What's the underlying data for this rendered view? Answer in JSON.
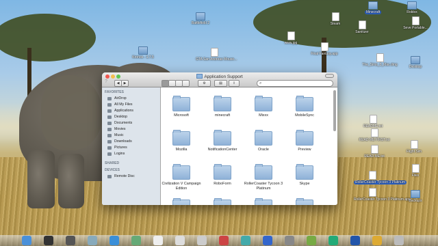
{
  "desktop_icons": [
    {
      "label": "Minecraft",
      "type": "folder",
      "sel": true
    },
    {
      "label": "Roblox",
      "type": "folder",
      "sel": false
    },
    {
      "label": "Steam",
      "type": "doc",
      "sel": false
    },
    {
      "label": "Sanitizer",
      "type": "doc",
      "sel": false
    },
    {
      "label": "Seve Portable...",
      "type": "doc",
      "sel": false
    },
    {
      "label": "Kronos - 1.7.5",
      "type": "folder",
      "sel": false
    },
    {
      "label": "GTA San Andreas Mouse...",
      "type": "doc",
      "sel": false
    },
    {
      "label": "Battlefield 2",
      "type": "folder",
      "sel": false
    },
    {
      "label": "www.jpg",
      "type": "doc",
      "sel": false
    },
    {
      "label": "Final Fantasy.app",
      "type": "doc",
      "sel": false
    },
    {
      "label": "The_Sims_3_Mac.dmg",
      "type": "doc",
      "sel": false
    },
    {
      "label": "Desktop",
      "type": "folder",
      "sel": false
    },
    {
      "label": "README.txt",
      "type": "doc",
      "sel": false
    },
    {
      "label": "READ ME FIRST.txt",
      "type": "doc",
      "sel": false
    },
    {
      "label": "READ ME.txt",
      "type": "doc",
      "sel": false
    },
    {
      "label": "Flight Sim",
      "type": "doc",
      "sel": false
    },
    {
      "label": "RollerCoaster Tycoon 3 Platinum",
      "type": "doc",
      "sel": true
    },
    {
      "label": "RollerCoaster Tycoon 3 Platinum.app",
      "type": "doc",
      "sel": false
    },
    {
      "label": "Files",
      "type": "doc",
      "sel": false
    },
    {
      "label": "Backups",
      "type": "folder",
      "sel": false
    }
  ],
  "finder": {
    "title": "Application Support",
    "help_glyph": "?",
    "nav_back": "◀",
    "nav_forward": "▶",
    "action_glyph": "⚙",
    "arrange_glyph": "▤",
    "share_glyph": "⇪",
    "search_glyph": "⌕",
    "sidebar": {
      "favorites_header": "FAVORITES",
      "favorites": [
        "AirDrop",
        "All My Files",
        "Applications",
        "Desktop",
        "Documents",
        "Movies",
        "Music",
        "Downloads",
        "Pictures",
        "Logins"
      ],
      "shared_header": "SHARED",
      "devices_header": "DEVICES",
      "devices": [
        "Remote Disc"
      ]
    },
    "items": [
      "Microsoft",
      "minecraft",
      "Mixxx",
      "MobileSync",
      "Mozilla",
      "NotificationCenter",
      "Oracle",
      "Preview",
      "Civilization V Campaign Edition",
      "RoboForm",
      "RollerCoaster Tycoon 3 Platinum",
      "Skype",
      "",
      "",
      "",
      ""
    ]
  },
  "colors": {
    "window_bg": "#ffffff",
    "sidebar_bg": "#dde4eb",
    "selection": "#2b62c9",
    "close": "#f0584f",
    "minimize": "#f5be4f",
    "zoom": "#61c554"
  },
  "dock_icons": [
    "finder-icon",
    "dashboard-icon",
    "mission-control-icon",
    "mail-icon",
    "safari-icon",
    "photos-icon",
    "calendar-icon",
    "notes-icon",
    "reminders-icon",
    "photo-booth-icon",
    "itunes-icon",
    "app-store-icon",
    "system-preferences-icon",
    "minecraft-icon",
    "excel-icon",
    "word-icon",
    "chrome-icon",
    "trash-icon"
  ]
}
